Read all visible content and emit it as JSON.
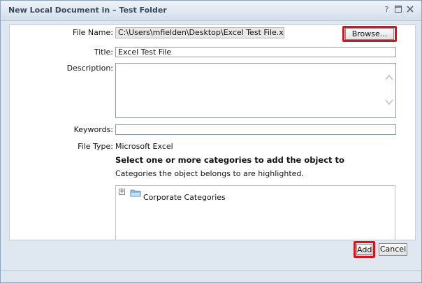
{
  "window": {
    "title": "New Local Document in – Test Folder",
    "controls": {
      "help": "?",
      "maximize": "maximize-icon",
      "close": "close-icon"
    }
  },
  "form": {
    "file_name": {
      "label": "File Name:",
      "value": "C:\\Users\\mfielden\\Desktop\\Excel Test File.xlsx",
      "browse_label": "Browse..."
    },
    "title": {
      "label": "Title:",
      "value": "Excel Test File"
    },
    "description": {
      "label": "Description:",
      "value": ""
    },
    "keywords": {
      "label": "Keywords:",
      "value": ""
    },
    "file_type": {
      "label": "File Type:",
      "value": "Microsoft Excel"
    }
  },
  "categories": {
    "heading": "Select one or more categories to add the object to",
    "hint": "Categories the object belongs to are highlighted.",
    "tree": [
      {
        "label": "Corporate Categories",
        "expander": "+",
        "icon": "folder-icon"
      }
    ]
  },
  "footer": {
    "add_label": "Add",
    "cancel_label": "Cancel"
  },
  "colors": {
    "highlight": "#e0101a",
    "dialog_bg": "#dfe7f1"
  }
}
